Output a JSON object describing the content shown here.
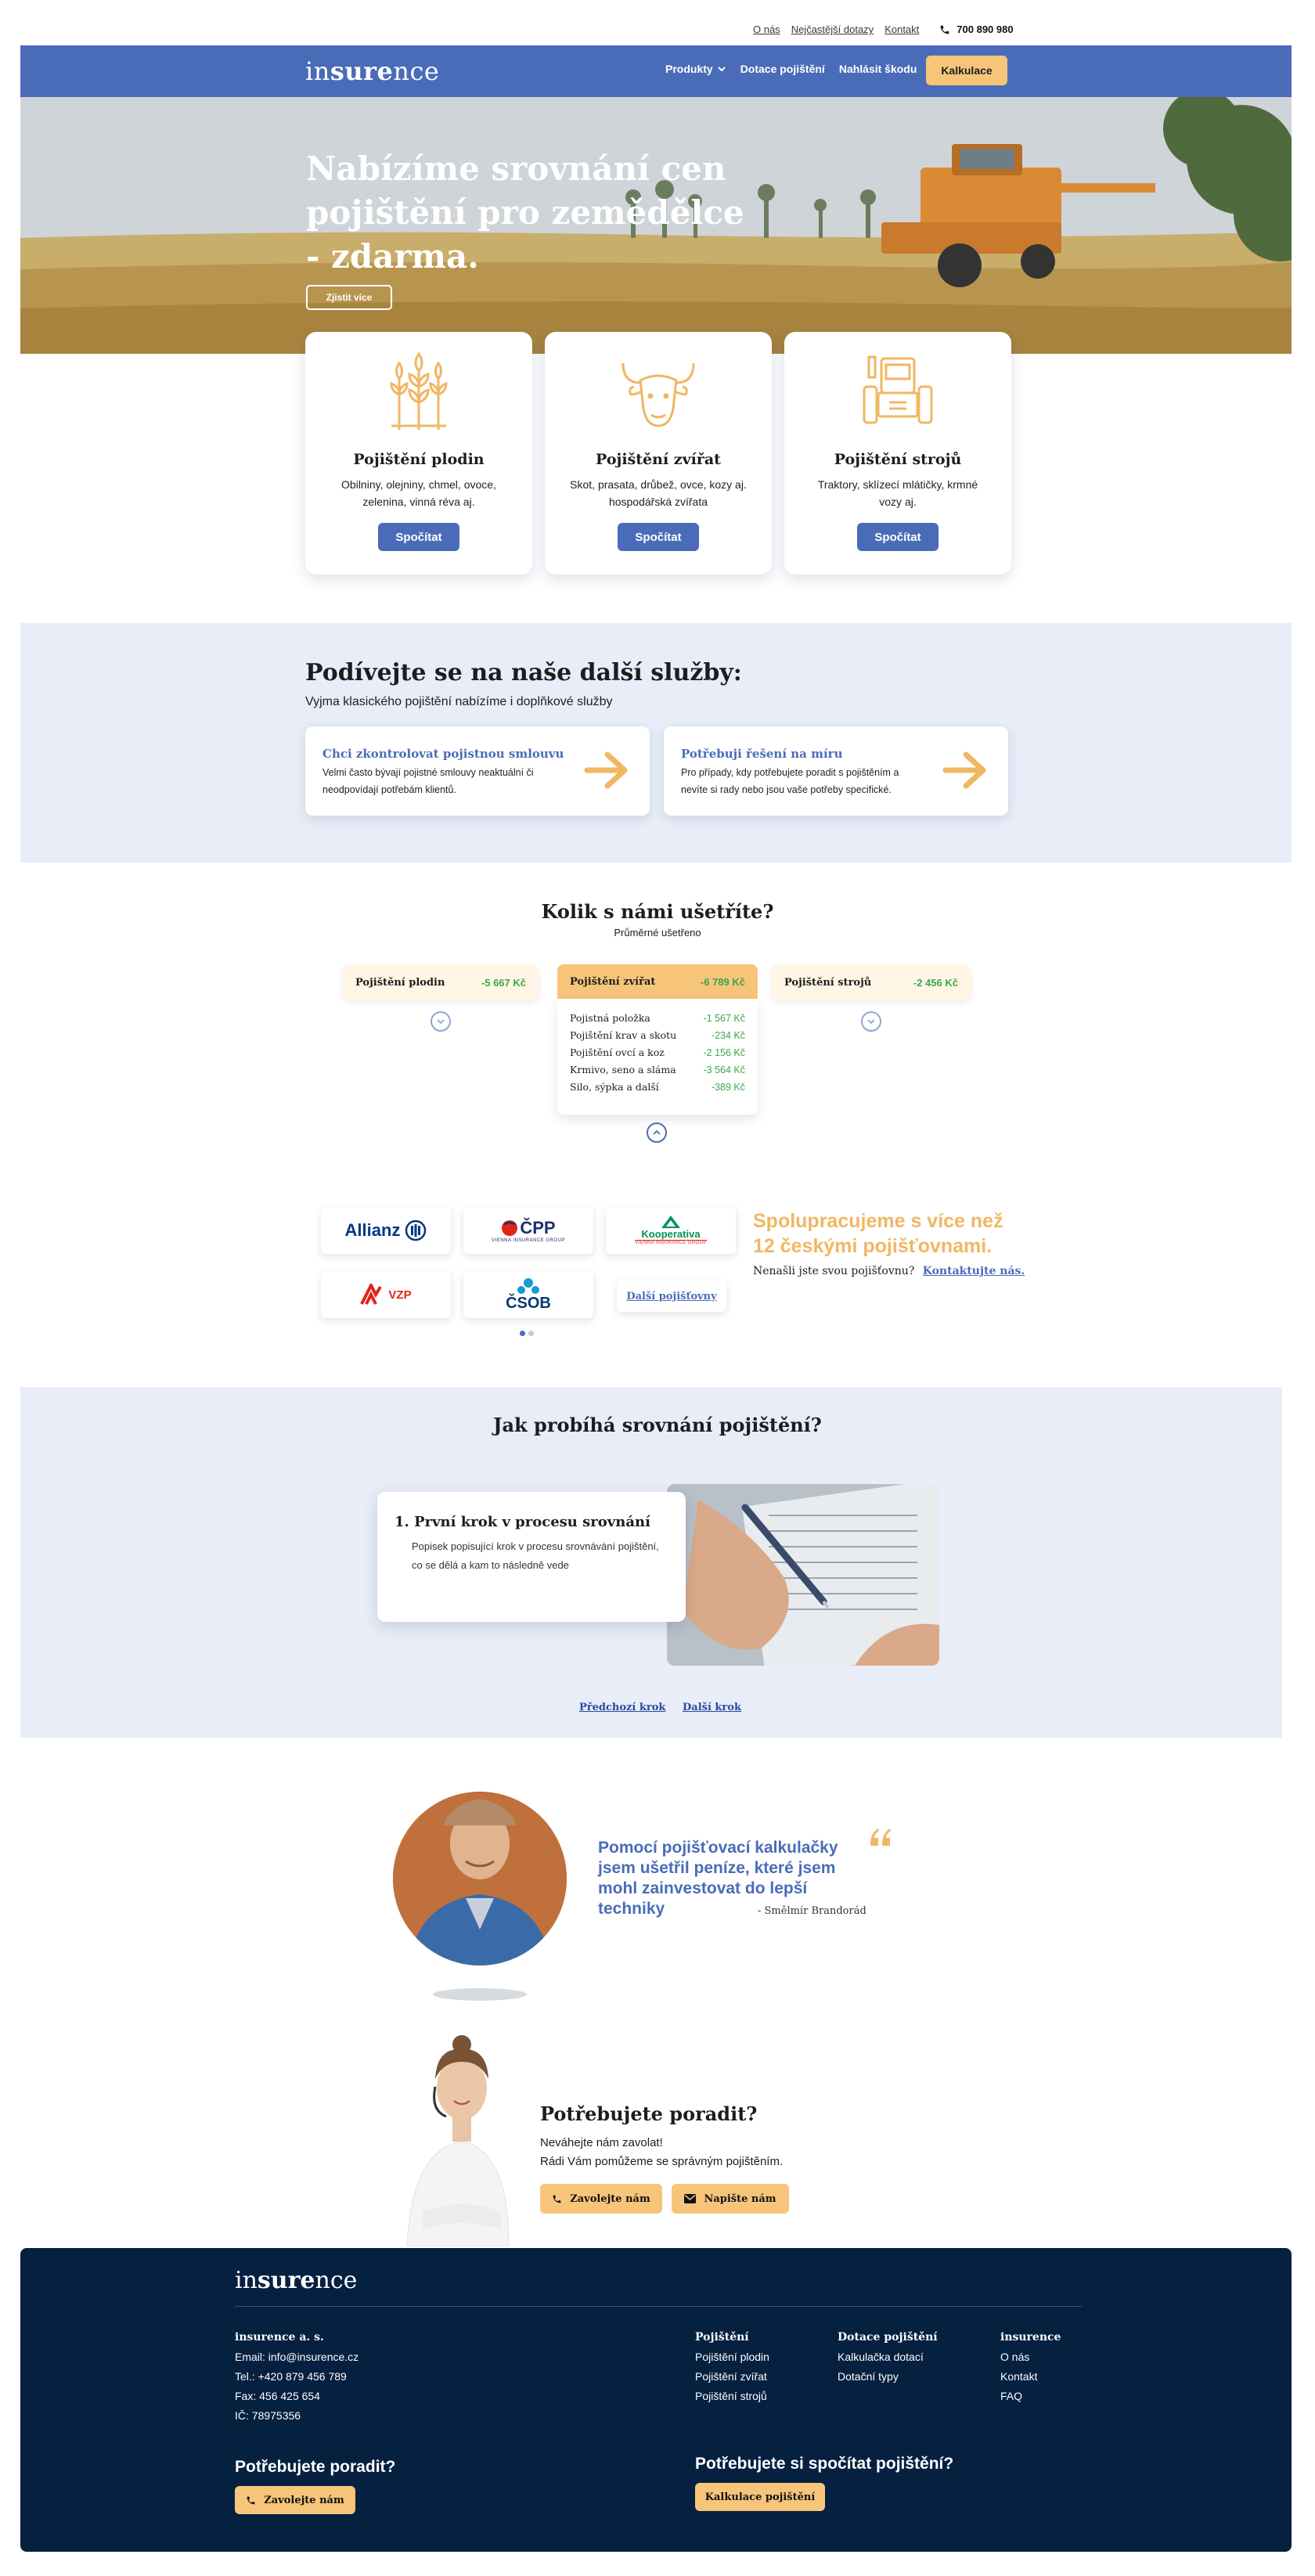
{
  "util": {
    "about": "O nás",
    "faq": "Nejčastější dotazy",
    "contact": "Kontakt",
    "phone": "700 890 980"
  },
  "nav": {
    "logo_pre": "in",
    "logo_bold": "sure",
    "logo_post": "nce",
    "products": "Produkty",
    "subsidies": "Dotace pojištění",
    "report": "Nahlásit škodu",
    "calc": "Kalkulace"
  },
  "hero": {
    "title": "Nabízíme srovnání cen pojištění pro zemědělce - zdarma.",
    "more": "Zjistit více"
  },
  "products": [
    {
      "title": "Pojištění plodin",
      "desc": "Obilniny, olejniny, chmel, ovoce, zelenina, vinná réva aj.",
      "button": "Spočítat",
      "icon": "wheat-icon"
    },
    {
      "title": "Pojištění zvířat",
      "desc": "Skot, prasata, drůbež, ovce, kozy aj. hospodářská zvířata",
      "button": "Spočítat",
      "icon": "bull-icon"
    },
    {
      "title": "Pojištění strojů",
      "desc": "Traktory, sklízecí mlátičky, krmné vozy aj.",
      "button": "Spočítat",
      "icon": "tractor-icon"
    }
  ],
  "services": {
    "title": "Podívejte se na naše další služby:",
    "subtitle": "Vyjma klasického pojištění nabízíme i doplňkové služby",
    "items": [
      {
        "title": "Chci zkontrolovat pojistnou smlouvu",
        "desc": "Velmi často bývají pojistné smlouvy neaktuální či neodpovídají potřebám klientů."
      },
      {
        "title": "Potřebuji řešení na míru",
        "desc": "Pro případy, kdy potřebujete poradit s pojištěním a nevíte si rady nebo jsou vaše potřeby specifické."
      }
    ]
  },
  "savings": {
    "title": "Kolik s námi ušetříte?",
    "subtitle": "Průměrné ušetřeno",
    "cards": [
      {
        "name": "Pojištění plodin",
        "value": "-5 667 Kč"
      },
      {
        "name": "Pojištění zvířat",
        "value": "-6 789 Kč"
      },
      {
        "name": "Pojištění strojů",
        "value": "-2 456 Kč"
      }
    ],
    "details": [
      {
        "name": "Pojistná položka",
        "value": "-1 567 Kč"
      },
      {
        "name": "Pojištění krav a skotu",
        "value": "-234 Kč"
      },
      {
        "name": "Pojištění ovcí a koz",
        "value": "-2 156 Kč"
      },
      {
        "name": "Krmivo, seno a sláma",
        "value": "-3 564 Kč"
      },
      {
        "name": "Silo, sýpka a další",
        "value": "-389 Kč"
      }
    ]
  },
  "partners": {
    "title": "Spolupracujeme s více než 12 českými pojišťovnami.",
    "question": "Nenašli jste svou pojišťovnu?",
    "contact": "Kontaktujte nás.",
    "logos": [
      "Allianz",
      "ČPP",
      "Kooperativa",
      "VZP",
      "ČSOB"
    ],
    "cpp_sub": "VIENNA INSURANCE GROUP",
    "koop_sub": "VIENNA INSURANCE GROUP",
    "more": "Další pojišťovny"
  },
  "process": {
    "title": "Jak probíhá srovnání pojištění?",
    "step_num": "1.",
    "step_title": "První krok v procesu srovnání",
    "step_desc": "Popisek popisující krok v procesu srovnávání pojištění, co se dělá a kam to následně vede",
    "prev": "Předchozí krok",
    "next": "Další krok"
  },
  "testimonial": {
    "quote": "Pomocí pojišťovací kalkulačky jsem ušetřil peníze, které jsem mohl zainvestovat do lepší techniky",
    "author": "- Smělmír Brandorád"
  },
  "advice": {
    "title": "Potřebujete poradit?",
    "line1": "Neváhejte nám zavolat!",
    "line2": "Rádi Vám pomůžeme se správným pojištěním.",
    "call": "Zavolejte nám",
    "write": "Napište nám"
  },
  "footer": {
    "company": "insurence a. s.",
    "email": "Email: info@insurence.cz",
    "tel": "Tel.: +420 879 456 789",
    "fax": "Fax: 456 425 654",
    "ic": "IČ: 78975356",
    "col1": {
      "title": "Pojištění",
      "items": [
        "Pojištění plodin",
        "Pojištění zvířat",
        "Pojištění strojů"
      ]
    },
    "col2": {
      "title": "Dotace pojištění",
      "items": [
        "Kalkulačka dotací",
        "Dotační typy"
      ]
    },
    "col3": {
      "title": "insurence",
      "items": [
        "O nás",
        "Kontakt",
        "FAQ"
      ]
    },
    "cta1": "Potřebujete poradit?",
    "cta1_btn": "Zavolejte nám",
    "cta2": "Potřebujete si spočítat pojištění?",
    "cta2_btn": "Kalkulace pojištění"
  },
  "colors": {
    "primary": "#4a6cb8",
    "accent": "#f6c57a",
    "footer": "#062040",
    "saving": "#3aa84a",
    "soft_bg": "#e8edf7"
  }
}
